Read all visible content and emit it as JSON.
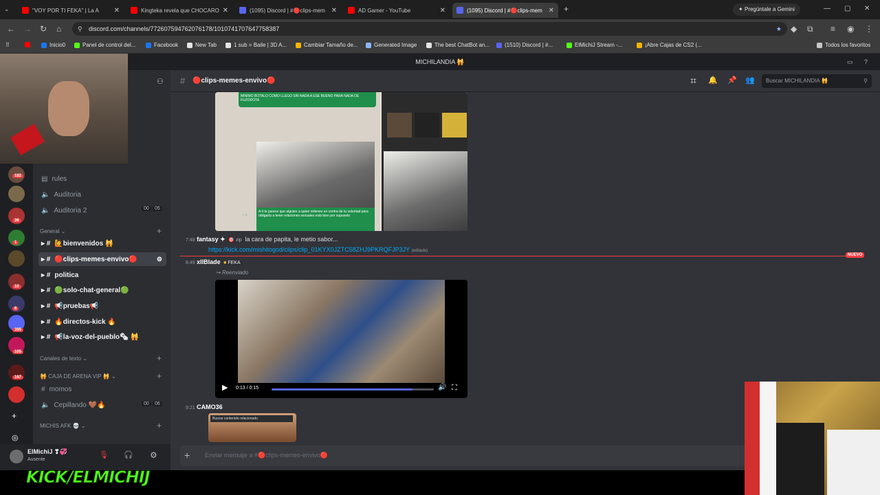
{
  "browser": {
    "tabs": [
      {
        "title": "\"VOY POR TI FEKA\" | La A",
        "color": "#ff0000"
      },
      {
        "title": "Kingteka revela que CHOCARO",
        "color": "#ff0000"
      },
      {
        "title": "(1095) Discord | #🔴clips-mem",
        "color": "#5865f2"
      },
      {
        "title": "AD Gamer - YouTube",
        "color": "#ff0000"
      },
      {
        "title": "(1095) Discord | #🔴clips-mem",
        "color": "#5865f2"
      }
    ],
    "gemini": "Pregúntale a Gemini",
    "url": "discord.com/channels/772607594762076178/1010741707647758387",
    "bookmarks": [
      "Inicio0",
      "Panel de control del...",
      "Facebook",
      "New Tab",
      "1 sub = Baile | 3D A...",
      "Cambiar Tamaño de...",
      "Generated Image",
      "The best ChatBot an...",
      "(1510) Discord | #...",
      "ElMichiJ Stream -...",
      "¡Abre Cajas de CS2 (..."
    ],
    "all_bookmarks": "Todos los favoritos"
  },
  "discord": {
    "server_title": "MICHILANDIA 🙀",
    "guild_badges": [
      "182",
      "36",
      "1",
      "10",
      "6",
      "395",
      "105",
      "167"
    ],
    "channels": [
      {
        "name": "rules"
      },
      {
        "name": "Auditoria"
      },
      {
        "name": "Auditoria 2",
        "c1": "00",
        "c2": "05"
      }
    ],
    "cat_general": "General",
    "text_channels": [
      "🙋bienvenidos 🙀",
      "🔴clips-memes-envivo🔴",
      "politica",
      "🟢solo-chat-general🟢",
      "📢pruebas📢",
      "🔥directos-kick 🔥",
      "📢la-voz-del-pueblo🗞 🙀"
    ],
    "cat_textos": "Canales de texto",
    "cat_caja": "🙀 CAJA DE ARENA VIP 🙀",
    "momos": "momos",
    "cepillando": "Cepillando 🤎🔥",
    "cep_c1": "00",
    "cep_c2": "06",
    "cat_afk": "MICHIS AFK 💀",
    "user": {
      "name": "ElMichiJ ❣💞",
      "status": "Ausente"
    },
    "header": {
      "channel": "🔴clips-memes-envivo🔴",
      "search": "Buscar MICHILANDIA 🙀"
    },
    "messages": {
      "m0_top": "MINIMO BOTALO COMO LLEGO SIN NADA A ESE BUENO PARA NADA DE FUZODOTA",
      "m0_caption": "A ti te parece que alguien a quien retienes en contra de tu voluntad para obligarla a tener relaciones sexuales está bien por supuesto",
      "m1_time": "7:48",
      "m1_author": "fantasy ✦",
      "m1_tag": "🎯 zip",
      "m1_text": "la cara de papita, le metio sabor...",
      "m1_link": "https://kick.com/mishitogod/clips/clip_01KYX0JZTC58ZHJ9PKRQFJP3JY",
      "m1_edited": "(editado)",
      "new_label": "NUEVO",
      "m2_time": "8:49",
      "m2_author": "xllBlade",
      "m2_tag": "FEKA",
      "m2_forward": "Reenviado",
      "video_time": "0:13 / 0:15",
      "video_progress": 0.87,
      "m3_time": "9:21",
      "m3_author": "CAMO36",
      "m3_preview": "Buscar contenido relacionado"
    },
    "composer_placeholder": "Enviar mensaje a #🔴clips-memes-envivo🔴"
  },
  "stream_overlay": {
    "kick": "KICK/ELMICHIJ"
  },
  "colors": {
    "accent": "#5865f2",
    "new_line": "#f23f43",
    "kick": "#53fc18"
  }
}
